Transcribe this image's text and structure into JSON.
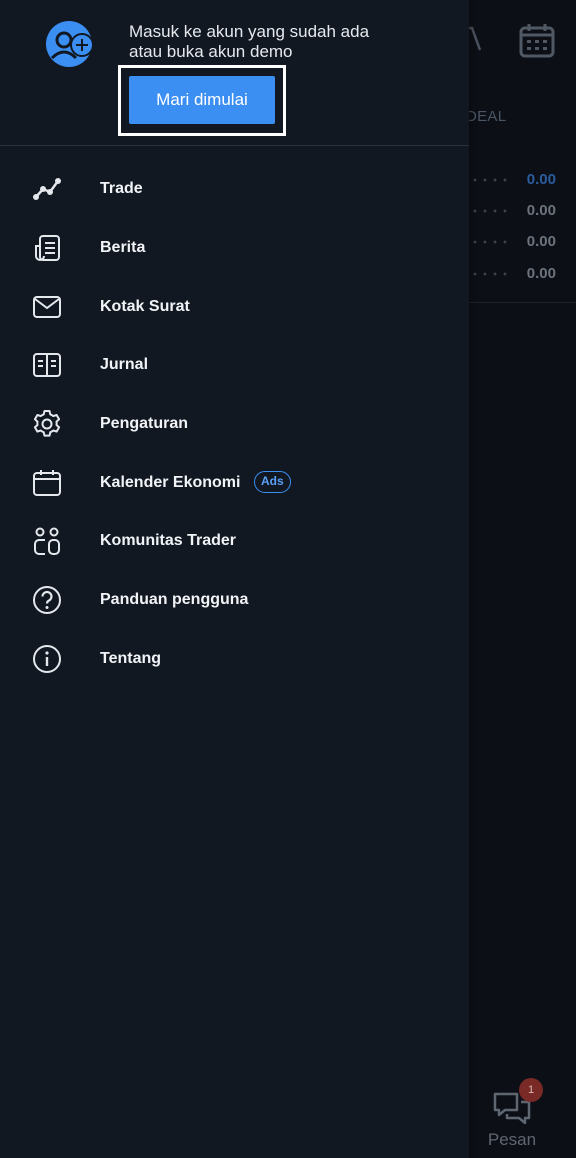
{
  "drawer": {
    "header": {
      "line1": "Masuk ke akun yang sudah ada",
      "line2": "atau buka akun demo",
      "cta_label": "Mari dimulai"
    },
    "menu": [
      {
        "label": "Trade",
        "icon": "trend-line-icon"
      },
      {
        "label": "Berita",
        "icon": "news-icon"
      },
      {
        "label": "Kotak Surat",
        "icon": "envelope-icon"
      },
      {
        "label": "Jurnal",
        "icon": "journal-book-icon"
      },
      {
        "label": "Pengaturan",
        "icon": "gear-icon"
      },
      {
        "label": "Kalender Ekonomi",
        "icon": "calendar-icon",
        "badge": "Ads"
      },
      {
        "label": "Komunitas Trader",
        "icon": "community-icon"
      },
      {
        "label": "Panduan pengguna",
        "icon": "help-circle-icon"
      },
      {
        "label": "Tentang",
        "icon": "info-circle-icon"
      }
    ]
  },
  "background": {
    "column_header": "DEAL",
    "values": [
      "0.00",
      "0.00",
      "0.00",
      "0.00"
    ],
    "pesan_label": "Pesan",
    "pesan_badge": "1"
  },
  "colors": {
    "accent": "#3b8ff2",
    "drawer_bg": "#111822",
    "text": "#f1f3f6"
  }
}
